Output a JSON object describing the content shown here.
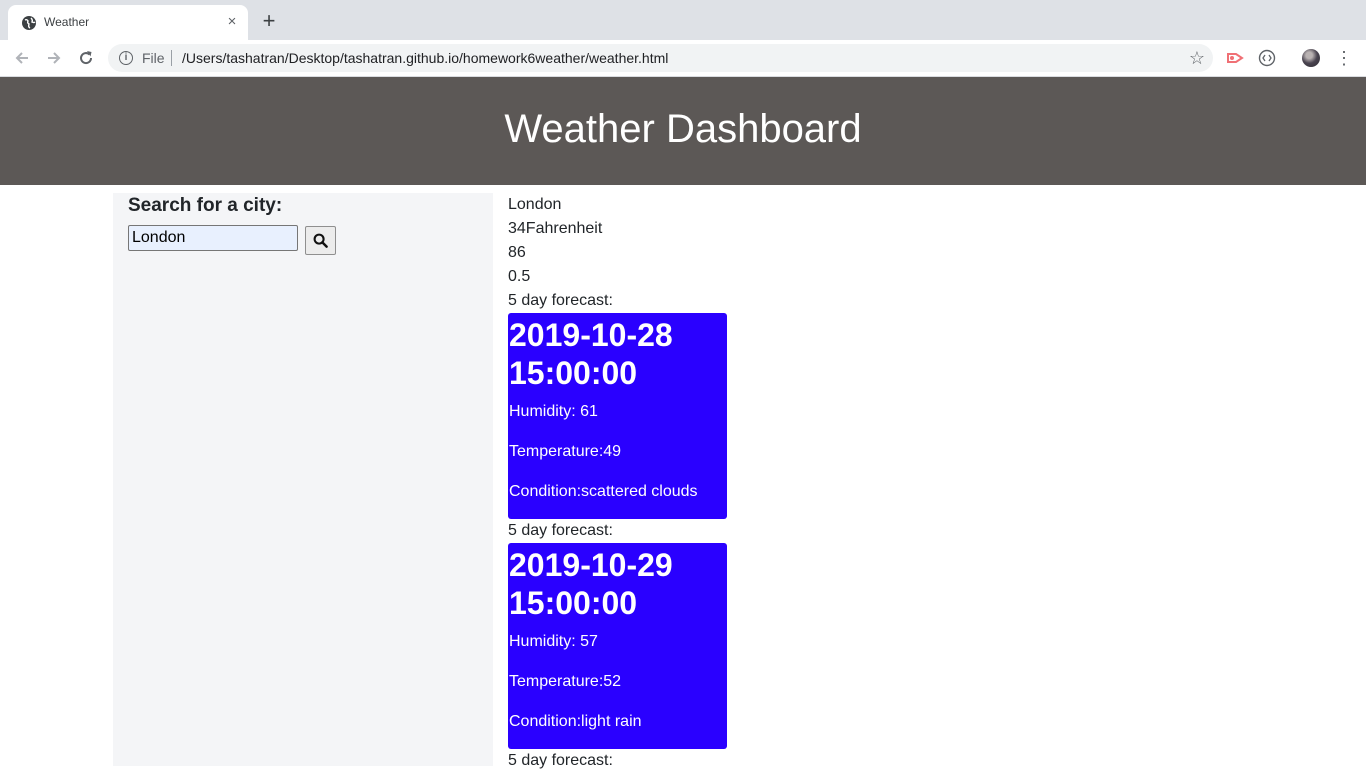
{
  "browser": {
    "tab_title": "Weather",
    "tab_close": "×",
    "new_tab": "+",
    "scheme": "File",
    "url": "/Users/tashatran/Desktop/tashatran.github.io/homework6weather/weather.html"
  },
  "header": {
    "title": "Weather Dashboard"
  },
  "search": {
    "label": "Search for a city:",
    "value": "London",
    "button_icon": "search-icon"
  },
  "current": {
    "city": "London",
    "temperature": "34Fahrenheit",
    "humidity": "86",
    "wind": "0.5"
  },
  "forecast": [
    {
      "heading": "5 day forecast:",
      "date": "2019-10-28",
      "time": "15:00:00",
      "humidity": "Humidity: 61",
      "temperature": "Temperature:49",
      "condition": "Condition:scattered clouds"
    },
    {
      "heading": "5 day forecast:",
      "date": "2019-10-29",
      "time": "15:00:00",
      "humidity": "Humidity: 57",
      "temperature": "Temperature:52",
      "condition": "Condition:light rain"
    },
    {
      "heading": "5 day forecast:"
    }
  ],
  "colors": {
    "header_bg": "#5c5856",
    "card_bg": "#2a00ff",
    "sidebar_bg": "#f4f5f7"
  }
}
